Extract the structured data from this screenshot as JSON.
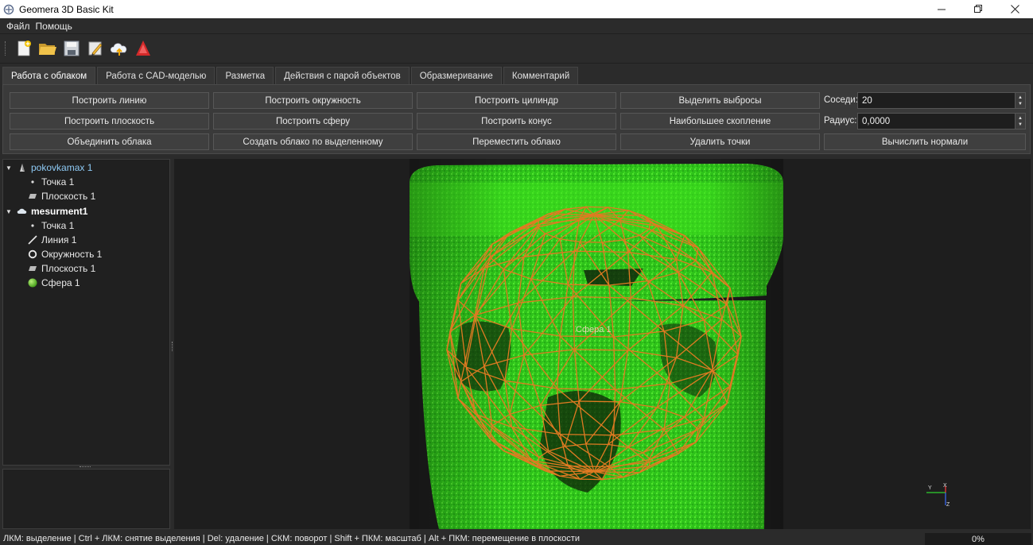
{
  "window": {
    "title": "Geomera 3D Basic Kit",
    "minimize_icon": "minimize-icon",
    "restore_icon": "restore-icon",
    "close_icon": "close-icon"
  },
  "menu": {
    "file": "Файл",
    "help": "Помощь"
  },
  "toolbar": {
    "icons": [
      "new-document-icon",
      "open-folder-icon",
      "save-icon",
      "edit-icon",
      "cloud-upload-icon",
      "cad-icon"
    ]
  },
  "tabs": [
    {
      "label": "Работа с облаком",
      "active": true
    },
    {
      "label": "Работа с CAD-моделью",
      "active": false
    },
    {
      "label": "Разметка",
      "active": false
    },
    {
      "label": "Действия с парой объектов",
      "active": false
    },
    {
      "label": "Образмеривание",
      "active": false
    },
    {
      "label": "Комментарий",
      "active": false
    }
  ],
  "actions": {
    "build_line": "Построить линию",
    "build_circle": "Построить окружность",
    "build_cylinder": "Построить цилиндр",
    "select_outliers": "Выделить выбросы",
    "build_plane": "Построить плоскость",
    "build_sphere": "Построить сферу",
    "build_cone": "Построить конус",
    "largest_cluster": "Наибольшее скопление",
    "merge_clouds": "Объединить облака",
    "create_cloud_from_selection": "Создать облако по выделенному",
    "move_cloud": "Переместить облако",
    "delete_points": "Удалить точки",
    "compute_normals": "Вычислить нормали"
  },
  "params": {
    "neighbors_label": "Соседи:",
    "neighbors_value": "20",
    "radius_label": "Радиус:",
    "radius_value": "0,0000"
  },
  "tree": {
    "group1": {
      "label": "pokovkamax 1",
      "children": [
        "Точка 1",
        "Плоскость 1"
      ]
    },
    "group2": {
      "label": "mesurment1",
      "children": [
        "Точка 1",
        "Линия 1",
        "Окружность 1",
        "Плоскость 1",
        "Сфера 1"
      ]
    }
  },
  "viewport": {
    "sphere_label": "Сфера 1",
    "axes": {
      "x": "X",
      "y": "Y",
      "z": "Z"
    },
    "colors": {
      "cloud": "#39e61f",
      "sphere": "#e07a22",
      "background": "#1e1e1e"
    }
  },
  "status": {
    "hint": "ЛКМ: выделение | Ctrl + ЛКМ: снятие выделения | Del: удаление | СКМ: поворот | Shift + ПКМ: масштаб | Alt + ПКМ: перемещение в плоскости",
    "progress": "0%"
  }
}
